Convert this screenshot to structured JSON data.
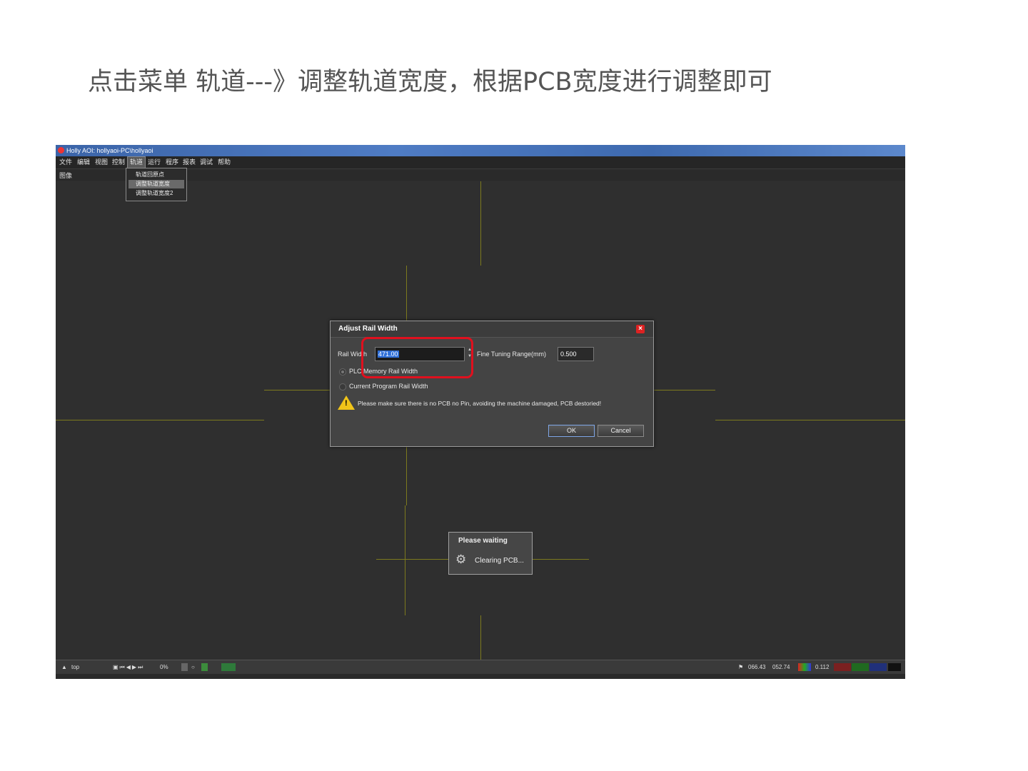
{
  "caption": "点击菜单 轨道---》调整轨道宽度，根据PCB宽度进行调整即可",
  "window": {
    "title": "Holly AOI: hollyaoi-PC\\hollyaoi"
  },
  "menubar": {
    "items": [
      "文件",
      "编辑",
      "视图",
      "控制",
      "轨道",
      "运行",
      "程序",
      "报表",
      "调试",
      "帮助"
    ]
  },
  "toolbar2": {
    "label": "图像"
  },
  "rail_menu": {
    "items": [
      "轨道回原点",
      "调整轨道宽度",
      "调整轨道宽度2"
    ],
    "selected_index": 1
  },
  "dialog": {
    "title": "Adjust Rail Width",
    "close_glyph": "×",
    "rail_width_label": "Rail Width",
    "rail_width_value": "471.00",
    "fine_tuning_label": "Fine Tuning Range(mm)",
    "fine_tuning_value": "0.500",
    "radio_plc": "PLC Memory Rail Width",
    "radio_current": "Current Program Rail Width",
    "warning": "Please make sure there is no PCB no Pin, avoiding the machine damaged, PCB destoried!",
    "ok_label": "OK",
    "cancel_label": "Cancel"
  },
  "wait_popup": {
    "title": "Please waiting",
    "status": "Clearing PCB..."
  },
  "statusbar": {
    "view_label": "top",
    "zoom": "0%",
    "coord_x": "066.43",
    "coord_y": "052.74",
    "value": "0.112"
  },
  "colors": {
    "highlight": "#e0101e",
    "crosshair": "#7d7a1e",
    "titlebar": "#3b64a8"
  }
}
